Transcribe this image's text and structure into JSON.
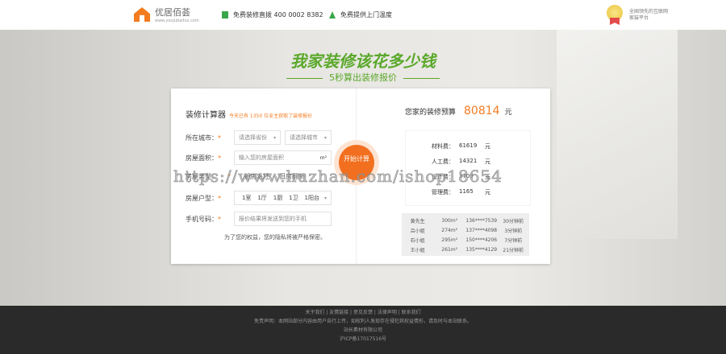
{
  "header": {
    "logo_name": "优居佰荟",
    "logo_url": "www.youjubaihui.com",
    "hotline": "免费装修直拨 400 0002 8382",
    "service": "免费提供上门温度",
    "badge": "全国领先的互联网家装平台"
  },
  "hero": {
    "title": "我家装修该花多少钱",
    "subtitle": "5秒算出装修报价"
  },
  "calc": {
    "title": "装修计算器",
    "note": "今天已有 1350 位业主获取了装修报价",
    "city_label": "所在城市：",
    "province_ph": "请选择省份",
    "city_ph": "请选择城市",
    "area_label": "房屋面积：",
    "area_ph": "输入您的房屋面积",
    "area_unit": "m²",
    "type_label": "房屋类型：",
    "type_opts": [
      "新房毛坯",
      "旧房翻新"
    ],
    "layout_label": "房屋户型：",
    "layout": [
      "1室",
      "1厅",
      "1厨",
      "1卫",
      "1阳台"
    ],
    "phone_label": "手机号码：",
    "phone_ph": "报价结果将发送到您的手机",
    "hint": "为了您的权益，您的隐私将被严格保密。",
    "go": "开始计算"
  },
  "result": {
    "label": "您家的装修预算",
    "total": "80814",
    "unit": "元",
    "fees": [
      {
        "k": "材料费：",
        "v": "61619",
        "u": "元"
      },
      {
        "k": "人工费：",
        "v": "14321",
        "u": "元"
      },
      {
        "k": "设计费：",
        "v": "3709",
        "u": "元"
      },
      {
        "k": "管理费：",
        "v": "1165",
        "u": "元"
      }
    ],
    "list": [
      [
        "黄先生",
        "300m²",
        "136****7539",
        "30分钟前"
      ],
      [
        "吕小姐",
        "274m²",
        "137****4098",
        "3分钟前"
      ],
      [
        "石小姐",
        "295m²",
        "150****4206",
        "7分钟前"
      ],
      [
        "王小姐",
        "261m²",
        "135****4129",
        "21分钟前"
      ]
    ]
  },
  "footer": {
    "links": "关于我们 | 友情链接 | 意见反馈 | 法律声明 | 联系我们",
    "disclaimer": "免责声明：本网站部分内容由用户自行上传，如权利人发现存在侵犯其权益情形，请及时与本站联系。",
    "company": "站长素材有限公司",
    "icp": "沪ICP备17017516号"
  },
  "watermark": "https://www.huzhan.com/ishop18654"
}
